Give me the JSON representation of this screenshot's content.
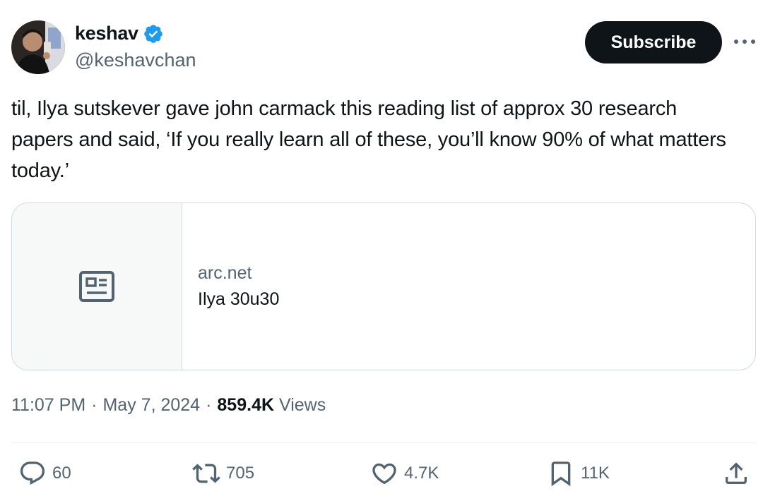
{
  "author": {
    "display_name": "keshav",
    "handle": "@keshavchan",
    "verified": true
  },
  "header": {
    "subscribe_label": "Subscribe",
    "more_icon": "more-dots-icon"
  },
  "tweet": {
    "text": "til, Ilya sutskever gave john carmack this reading list of approx 30 research papers and said, ‘If you really learn all of these, you’ll know 90% of what matters today.’"
  },
  "card": {
    "icon": "article-icon",
    "domain": "arc.net",
    "title": "Ilya 30u30"
  },
  "meta": {
    "time": "11:07 PM",
    "sep1": "·",
    "date": "May 7, 2024",
    "sep2": "·",
    "views_count": "859.4K",
    "views_label": "Views"
  },
  "actions": {
    "replies": "60",
    "reposts": "705",
    "likes": "4.7K",
    "bookmarks": "11K"
  },
  "colors": {
    "text_primary": "#0f1419",
    "text_secondary": "#536471",
    "verified_blue": "#1d9bf0",
    "border": "#cfd9de"
  }
}
